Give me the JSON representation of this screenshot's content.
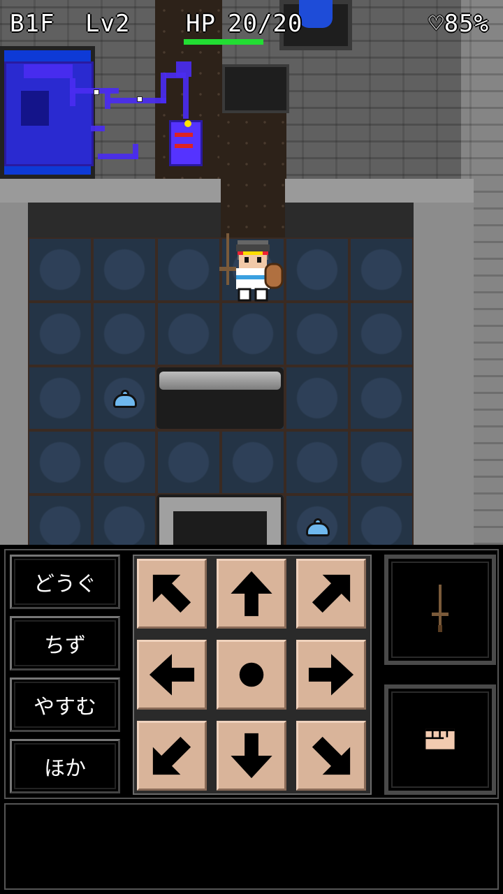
{
  "hud": {
    "floor": "B1F",
    "level": "Lv2",
    "hp_label": "HP",
    "hp_value": "20/20",
    "hp_fraction": 1.0,
    "hunger": "♡85%"
  },
  "menu": {
    "items": [
      {
        "label": "どうぐ"
      },
      {
        "label": "ちず"
      },
      {
        "label": "やすむ"
      },
      {
        "label": "ほか"
      }
    ]
  },
  "dpad": {
    "buttons": [
      "up-left",
      "up",
      "up-right",
      "left",
      "wait",
      "right",
      "down-left",
      "down",
      "down-right"
    ]
  },
  "actions": {
    "attack_icon": "sword-icon",
    "grab_icon": "fist-icon"
  },
  "colors": {
    "hp_bar": "#22dd33",
    "minimap": "#4a2cf0",
    "pad": "#d9b49a",
    "slime": "#6fb8ee"
  },
  "message": {
    "text": ""
  }
}
